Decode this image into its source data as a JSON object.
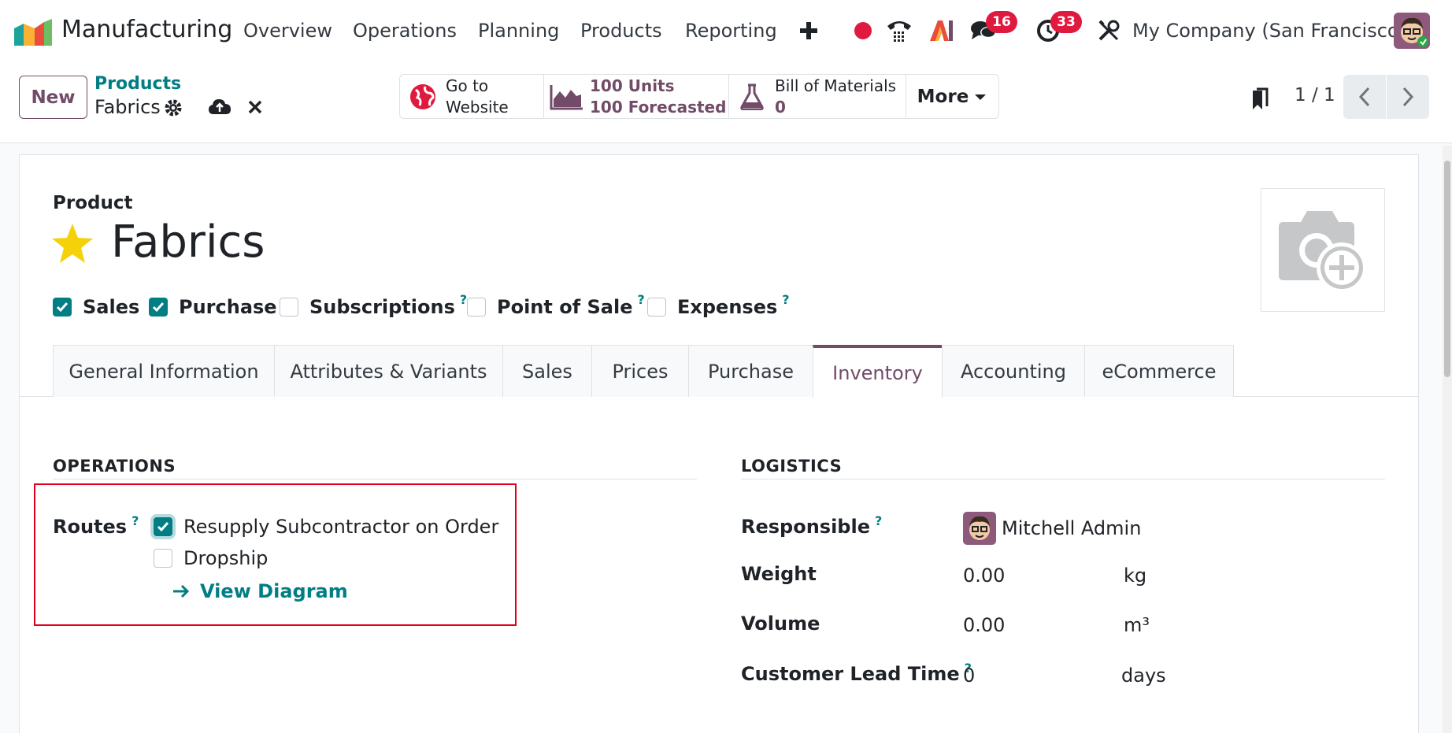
{
  "navbar": {
    "app_title": "Manufacturing",
    "menus": [
      "Overview",
      "Operations",
      "Planning",
      "Products",
      "Reporting"
    ],
    "messages_count": "16",
    "activities_count": "33",
    "company": "My Company (San Francisco)"
  },
  "control": {
    "new_label": "New",
    "breadcrumb_parent": "Products",
    "breadcrumb_current": "Fabrics",
    "smart_website_line1": "Go to",
    "smart_website_line2": "Website",
    "smart_units": "100 Units",
    "smart_forecast": "100 Forecasted",
    "smart_bom_label": "Bill of Materials",
    "smart_bom_count": "0",
    "more_label": "More",
    "pager": "1 / 1"
  },
  "form": {
    "product_label": "Product",
    "product_name": "Fabrics",
    "options": [
      {
        "label": "Sales",
        "checked": true
      },
      {
        "label": "Purchase",
        "checked": true
      },
      {
        "label": "Subscriptions",
        "checked": false
      },
      {
        "label": "Point of Sale",
        "checked": false
      },
      {
        "label": "Expenses",
        "checked": false
      }
    ],
    "help_mark": "?",
    "tabs": [
      "General Information",
      "Attributes & Variants",
      "Sales",
      "Prices",
      "Purchase",
      "Inventory",
      "Accounting",
      "eCommerce"
    ],
    "active_tab": "Inventory"
  },
  "operations": {
    "title": "OPERATIONS",
    "routes_label": "Routes",
    "routes": [
      {
        "label": "Resupply Subcontractor on Order",
        "checked": true
      },
      {
        "label": "Dropship",
        "checked": false
      }
    ],
    "view_diagram": "View Diagram"
  },
  "logistics": {
    "title": "LOGISTICS",
    "responsible_label": "Responsible",
    "responsible_value": "Mitchell Admin",
    "weight_label": "Weight",
    "weight_value": "0.00",
    "weight_unit": "kg",
    "volume_label": "Volume",
    "volume_value": "0.00",
    "volume_unit": "m³",
    "lead_label": "Customer Lead Time",
    "lead_value": "0",
    "lead_unit": "days"
  },
  "colors": {
    "brand": "#714b67",
    "accent": "#017e84",
    "badge": "#e0193f",
    "highlight": "#e0001b"
  },
  "icons": [
    "app-logo-icon",
    "plus-icon",
    "record-dot-icon",
    "phone-icon",
    "ai-icon",
    "chat-icon",
    "clock-icon",
    "tools-icon",
    "gear-icon",
    "cloud-upload-icon",
    "close-icon",
    "globe-icon",
    "area-chart-icon",
    "flask-icon",
    "caret-down-icon",
    "bookmark-icon",
    "chevron-left-icon",
    "chevron-right-icon",
    "star-icon",
    "camera-plus-icon",
    "check-icon",
    "arrow-right-icon"
  ]
}
